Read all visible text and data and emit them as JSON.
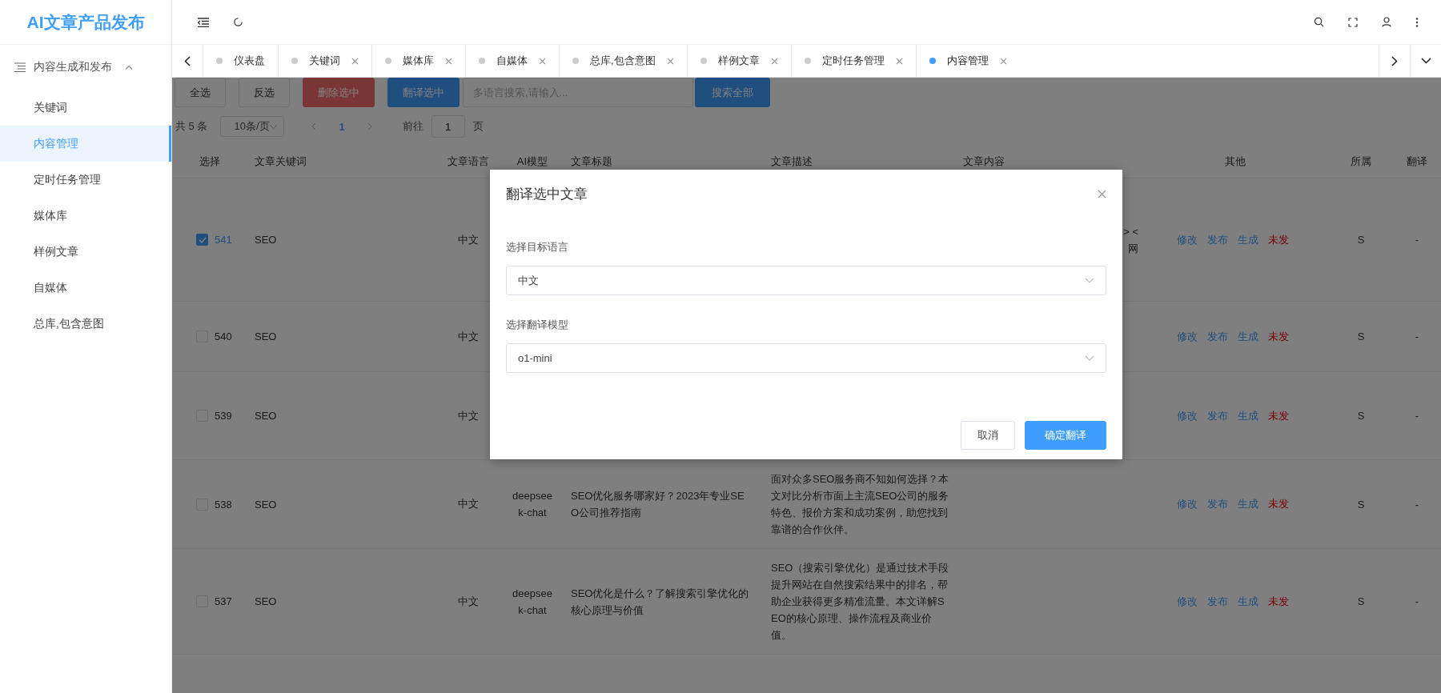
{
  "app_title": "AI文章产品发布",
  "sidebar": {
    "group": {
      "label": "内容生成和发布",
      "expanded": true
    },
    "items": [
      {
        "label": "关键词",
        "selected": false
      },
      {
        "label": "内容管理",
        "selected": true
      },
      {
        "label": "定时任务管理",
        "selected": false
      },
      {
        "label": "媒体库",
        "selected": false
      },
      {
        "label": "样例文章",
        "selected": false
      },
      {
        "label": "自媒体",
        "selected": false
      },
      {
        "label": "总库,包含意图",
        "selected": false
      }
    ]
  },
  "tabs": [
    {
      "label": "仪表盘",
      "selected": false,
      "closable": false
    },
    {
      "label": "关键词",
      "selected": false,
      "closable": true
    },
    {
      "label": "媒体库",
      "selected": false,
      "closable": true
    },
    {
      "label": "自媒体",
      "selected": false,
      "closable": true
    },
    {
      "label": "总库,包含意图",
      "selected": false,
      "closable": true
    },
    {
      "label": "样例文章",
      "selected": false,
      "closable": true
    },
    {
      "label": "定时任务管理",
      "selected": false,
      "closable": true
    },
    {
      "label": "内容管理",
      "selected": true,
      "closable": true
    }
  ],
  "toolbar": {
    "buttons": [
      {
        "label": "全选",
        "kind": "plain"
      },
      {
        "label": "反选",
        "kind": "plain"
      },
      {
        "label": "删除选中",
        "kind": "danger"
      },
      {
        "label": "翻译选中",
        "kind": "primary"
      }
    ],
    "search": {
      "placeholder": "多语言搜索,请输入..."
    },
    "search_button": "搜索全部"
  },
  "pagination": {
    "total": "共 5 条",
    "page_size": "10条/页",
    "current_page": "1",
    "goto_label": "前往",
    "goto_value": "1",
    "page_suffix": "页"
  },
  "table": {
    "columns": [
      "选择",
      "文章关键词",
      "文章语言",
      "AI模型",
      "文章标题",
      "文章描述",
      "文章内容",
      "其他",
      "所属",
      "翻译"
    ],
    "rows": [
      {
        "selected": true,
        "id": "541",
        "keyword": "SEO",
        "language": "中文",
        "content": [
          "> <",
          "网"
        ],
        "actions": [
          "修改",
          "发布",
          "生成"
        ],
        "status": {
          "label": "未发",
          "published": false
        },
        "belong": "S",
        "translation": "-"
      },
      {
        "selected": false,
        "id": "540",
        "keyword": "SEO",
        "language": "中文",
        "actions": [
          "修改",
          "发布",
          "生成"
        ],
        "status": {
          "label": "未发",
          "published": false
        },
        "belong": "S",
        "translation": "-"
      },
      {
        "selected": false,
        "id": "539",
        "keyword": "SEO",
        "language": "中文",
        "actions": [
          "修改",
          "发布",
          "生成"
        ],
        "status": {
          "label": "未发",
          "published": false
        },
        "belong": "S",
        "translation": "-"
      },
      {
        "selected": false,
        "id": "538",
        "keyword": "SEO",
        "language": "中文",
        "model": "deepseek-chat",
        "title": "SEO优化服务哪家好？2023年专业SEO公司推荐指南",
        "description": "面对众多SEO服务商不知如何选择？本文对比分析市面上主流SEO公司的服务特色、报价方案和成功案例，助您找到靠谱的合作伙伴。",
        "actions": [
          "修改",
          "发布",
          "生成"
        ],
        "status": {
          "label": "未发",
          "published": false
        },
        "belong": "S",
        "translation": "-"
      },
      {
        "selected": false,
        "id": "537",
        "keyword": "SEO",
        "language": "中文",
        "model": "deepseek-chat",
        "title": "SEO优化是什么？了解搜索引擎优化的核心原理与价值",
        "description": "SEO（搜索引擎优化）是通过技术手段提升网站在自然搜索结果中的排名，帮助企业获得更多精准流量。本文详解SEO的核心原理、操作流程及商业价值。",
        "actions": [
          "修改",
          "发布",
          "生成"
        ],
        "status": {
          "label": "未发",
          "published": false
        },
        "belong": "S",
        "translation": "-"
      }
    ]
  },
  "dialog": {
    "title": "翻译选中文章",
    "fields": [
      {
        "label": "选择目标语言",
        "value": "中文"
      },
      {
        "label": "选择翻译模型",
        "value": "o1-mini"
      }
    ],
    "buttons": [
      {
        "label": "取消",
        "kind": "plain"
      },
      {
        "label": "确定翻译",
        "kind": "primary"
      }
    ]
  }
}
